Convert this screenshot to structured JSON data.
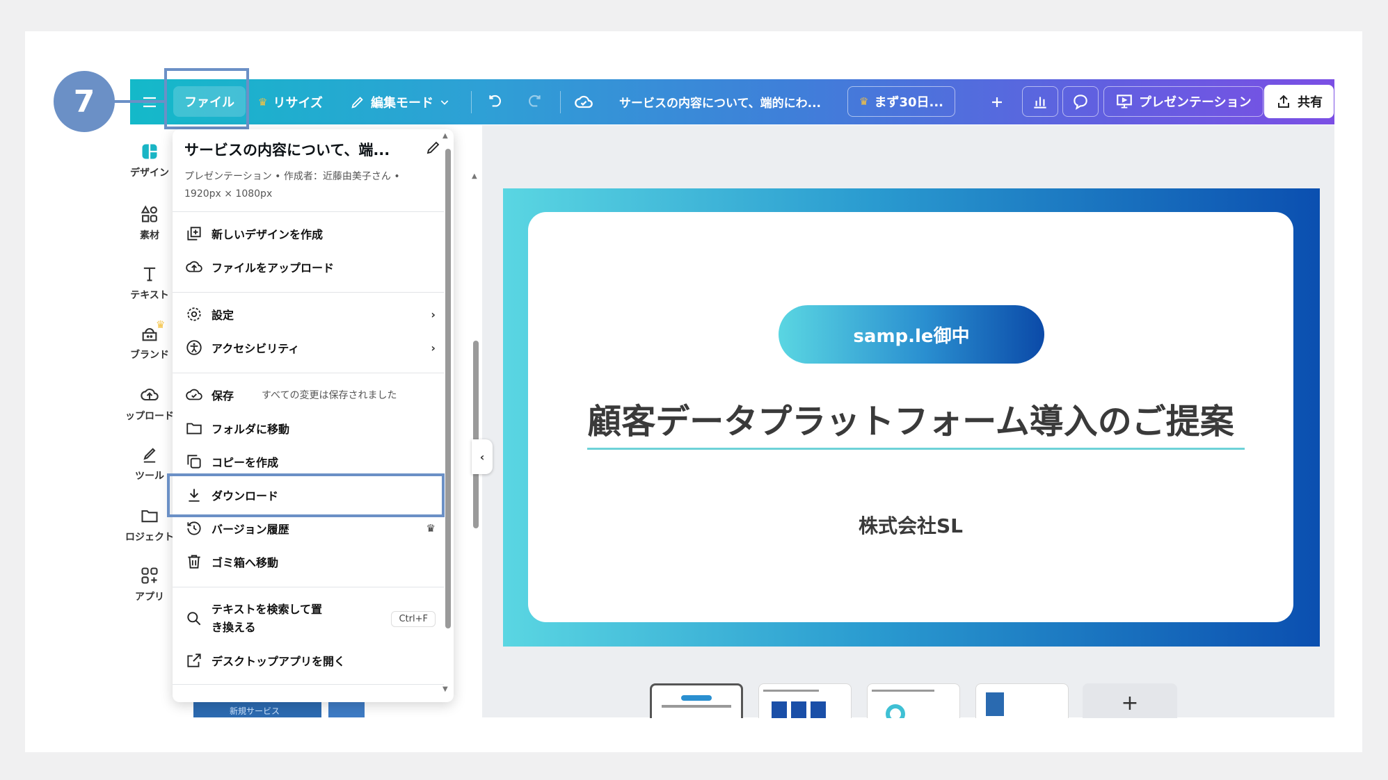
{
  "step_number": "7",
  "toolbar": {
    "file": "ファイル",
    "resize": "リサイズ",
    "edit_mode": "編集モード",
    "doc_title": "サービスの内容について、端的にわ...",
    "trial": "まず30日...",
    "present": "プレゼンテーション",
    "share": "共有"
  },
  "rail": {
    "design": "デザイン",
    "elements": "素材",
    "text": "テキスト",
    "brand": "ブランド",
    "upload": "ップロード",
    "tools": "ツール",
    "projects": "ロジェクト",
    "apps": "アプリ"
  },
  "panel_strip": "新規サービス",
  "menu": {
    "title": "サービスの内容について、端...",
    "meta": "プレゼンテーション • 作成者：近藤由美子さん • 1920px × 1080px",
    "items": {
      "new_design": "新しいデザインを作成",
      "upload": "ファイルをアップロード",
      "settings": "設定",
      "accessibility": "アクセシビリティ",
      "save": "保存",
      "save_note": "すべての変更は保存されました",
      "move_folder": "フォルダに移動",
      "copy": "コピーを作成",
      "download": "ダウンロード",
      "history": "バージョン履歴",
      "trash": "ゴミ箱へ移動",
      "find_replace": "テキストを検索して置き換える",
      "find_shortcut": "Ctrl+F",
      "desktop_app": "デスクトップアプリを開く"
    }
  },
  "slide": {
    "pill": "samp.le御中",
    "title": "顧客データプラットフォーム導入のご提案",
    "company": "株式会社SL"
  },
  "colors": {
    "step_badge": "#6b90c6",
    "toolbar_start": "#14b9c9",
    "toolbar_end": "#7b4fe4",
    "slide_accent": "#0b4fb0"
  }
}
